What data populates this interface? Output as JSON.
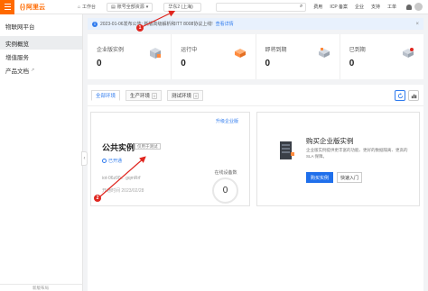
{
  "header": {
    "logo_mark": "(-)",
    "logo_text": "阿里云",
    "workbench": "工作台",
    "account": "账号全部资源",
    "region": "华东2 (上海)",
    "links": [
      "费用",
      "ICP 备案",
      "企业",
      "支持",
      "工单"
    ]
  },
  "sidebar": {
    "title": "物联网平台",
    "items": [
      {
        "label": "实例概览"
      },
      {
        "label": "增值服务"
      },
      {
        "label": "产品文档"
      }
    ]
  },
  "notice": {
    "text": "2023-01-06发布公告: 新版高级解析和ITT 8008协议上线!",
    "link": "查看详情"
  },
  "stats": [
    {
      "label": "企业版实例",
      "value": "0"
    },
    {
      "label": "运行中",
      "value": "0"
    },
    {
      "label": "即将到期",
      "value": "0"
    },
    {
      "label": "已到期",
      "value": "0"
    }
  ],
  "tabs": [
    {
      "label": "全部环境"
    },
    {
      "label": "生产环境",
      "count": "0"
    },
    {
      "label": "测试环境",
      "count": "0"
    }
  ],
  "instance_card": {
    "upgrade_link": "升级企业版",
    "title": "公共实例",
    "tag": "仅用于测试",
    "status": "已开通",
    "id_text": "iot-06z00... gqmRrf",
    "date_text": "开通时间 2023/02/28",
    "online_label": "在线设备数",
    "online_value": "0"
  },
  "buy_card": {
    "title": "购买企业版实例",
    "desc": "企业版实例提供更丰富的功能、更好的数据隔离、更高的 SLA 保障。",
    "buy_button": "购买实例",
    "quick_button": "快速入门"
  },
  "sidebar_footer": "新版布局",
  "annotations": [
    {
      "label": "1"
    },
    {
      "label": "2"
    }
  ],
  "colors": {
    "brand_orange": "#ff6a00",
    "link_blue": "#2f7bee",
    "annotation_red": "#e0261f"
  }
}
